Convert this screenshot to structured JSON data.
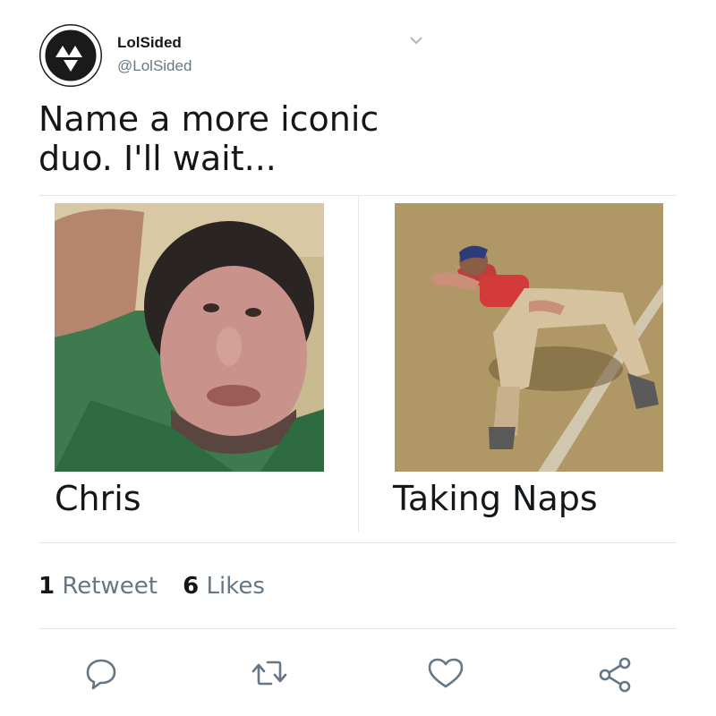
{
  "tweet": {
    "author": {
      "display_name": "LolSided",
      "handle": "@LolSided"
    },
    "text": "Name a more iconic duo. I'll wait...",
    "panels": [
      {
        "caption": "Chris",
        "image": "photo of a man in a green shirt"
      },
      {
        "caption": "Taking Naps",
        "image": "photo of a man lying on grass napping"
      }
    ],
    "stats": {
      "retweets_count": "1",
      "retweets_label": "Retweet",
      "likes_count": "6",
      "likes_label": "Likes"
    },
    "actions": [
      "reply-icon",
      "retweet-icon",
      "like-icon",
      "share-icon"
    ]
  },
  "colors": {
    "text": "#14171a",
    "secondary": "#657786",
    "divider": "#e1e8ed",
    "icon": "#657786"
  }
}
